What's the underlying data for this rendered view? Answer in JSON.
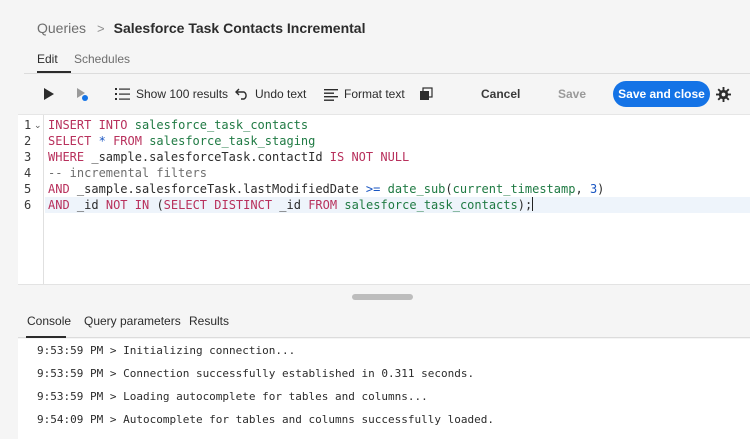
{
  "breadcrumb": {
    "root": "Queries",
    "separator": ">",
    "current": "Salesforce Task Contacts Incremental"
  },
  "tabs": [
    {
      "label": "Edit",
      "active": true
    },
    {
      "label": "Schedules",
      "active": false
    }
  ],
  "toolbar": {
    "show_results": "Show 100 results",
    "undo": "Undo text",
    "format": "Format text",
    "cancel": "Cancel",
    "save": "Save",
    "save_close": "Save and close"
  },
  "editor": {
    "line_numbers": [
      "1",
      "2",
      "3",
      "4",
      "5",
      "6"
    ],
    "lines": [
      {
        "kw1": "INSERT INTO",
        "id1": "salesforce_task_contacts"
      },
      {
        "kw1": "SELECT",
        "op1": "*",
        "kw2": "FROM",
        "id1": "salesforce_task_staging"
      },
      {
        "kw1": "WHERE",
        "pl1": "_sample.salesforceTask.contactId",
        "kw2": "IS NOT NULL"
      },
      {
        "cm1": "-- incremental filters"
      },
      {
        "kw1": "AND",
        "pl1": "_sample.salesforceTask.lastModifiedDate",
        "op1": ">=",
        "fn1": "date_sub",
        "pl2": "(",
        "fn2": "current_timestamp",
        "pl3": ",",
        "num1": "3",
        "pl4": ")"
      },
      {
        "kw1": "AND",
        "pl1": "_id",
        "kw2": "NOT IN",
        "pl2": "(",
        "kw3": "SELECT DISTINCT",
        "pl3": "_id",
        "kw4": "FROM",
        "id1": "salesforce_task_contacts",
        "pl4": ");"
      }
    ]
  },
  "console_tabs": [
    {
      "label": "Console",
      "active": true
    },
    {
      "label": "Query parameters",
      "active": false
    },
    {
      "label": "Results",
      "active": false
    }
  ],
  "console_logs": [
    "9:53:59 PM > Initializing connection...",
    "9:53:59 PM > Connection successfully established in 0.311 seconds.",
    "9:53:59 PM > Loading autocomplete for tables and columns...",
    "9:54:09 PM > Autocomplete for tables and columns successfully loaded."
  ],
  "colors": {
    "primary": "#1473e6",
    "keyword": "#b8305c",
    "identifier": "#1f7a43",
    "operator": "#1a56c2"
  },
  "icons": [
    "chevron-right-icon",
    "play-icon",
    "run-selection-icon",
    "list-icon",
    "undo-icon",
    "format-icon",
    "copy-icon",
    "gear-icon",
    "fold-chevron-icon"
  ]
}
